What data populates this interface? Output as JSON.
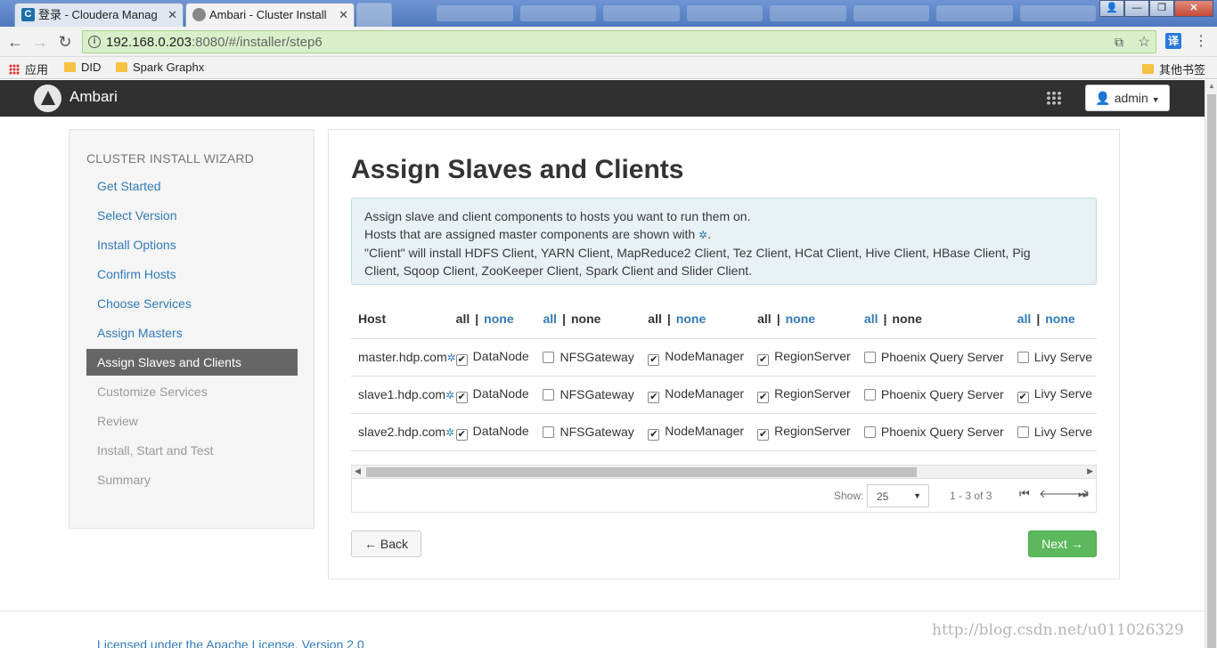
{
  "browser": {
    "tabs": [
      {
        "label": "登录 - Cloudera Manag",
        "favicon_color": "#1a6fa8",
        "favicon_letter": "C"
      },
      {
        "label": "Ambari - Cluster Install",
        "favicon_color": "#888888"
      }
    ],
    "url_host": "192.168.0.203",
    "url_rest": ":8080/#/installer/step6",
    "bookmarks": [
      {
        "label": "应用"
      },
      {
        "label": "DID"
      },
      {
        "label": "Spark Graphx"
      },
      {
        "label": "其他书签"
      }
    ],
    "translate_icon": "译"
  },
  "header": {
    "app_name": "Ambari",
    "admin_label": "admin"
  },
  "sidebar": {
    "title": "CLUSTER INSTALL WIZARD",
    "items": [
      {
        "label": "Get Started",
        "state": "link"
      },
      {
        "label": "Select Version",
        "state": "link"
      },
      {
        "label": "Install Options",
        "state": "link"
      },
      {
        "label": "Confirm Hosts",
        "state": "link"
      },
      {
        "label": "Choose Services",
        "state": "link"
      },
      {
        "label": "Assign Masters",
        "state": "link"
      },
      {
        "label": "Assign Slaves and Clients",
        "state": "active"
      },
      {
        "label": "Customize Services",
        "state": "disabled"
      },
      {
        "label": "Review",
        "state": "disabled"
      },
      {
        "label": "Install, Start and Test",
        "state": "disabled"
      },
      {
        "label": "Summary",
        "state": "disabled"
      }
    ]
  },
  "main": {
    "title": "Assign Slaves and Clients",
    "alert": {
      "line1": "Assign slave and client components to hosts you want to run them on.",
      "line2_pre": "Hosts that are assigned master components are shown with ",
      "line2_post": ".",
      "line3": "\"Client\" will install HDFS Client, YARN Client, MapReduce2 Client, Tez Client, HCat Client, Hive Client, HBase Client, Pig",
      "line4": "Client, Sqoop Client, ZooKeeper Client, Spark Client and Slider Client."
    },
    "table": {
      "host_header": "Host",
      "all_label": "all",
      "none_label": "none",
      "columns": [
        {
          "name": "DataNode",
          "active": "all"
        },
        {
          "name": "NFSGateway",
          "active": "none"
        },
        {
          "name": "NodeManager",
          "active": "all"
        },
        {
          "name": "RegionServer",
          "active": "all"
        },
        {
          "name": "Phoenix Query Server",
          "active": "none"
        },
        {
          "name": "Livy Serve",
          "active": "all"
        }
      ],
      "rows": [
        {
          "host": "master.hdp.com",
          "checks": [
            true,
            false,
            true,
            true,
            false,
            false
          ]
        },
        {
          "host": "slave1.hdp.com",
          "checks": [
            true,
            false,
            true,
            true,
            false,
            true
          ]
        },
        {
          "host": "slave2.hdp.com",
          "checks": [
            true,
            false,
            true,
            true,
            false,
            false
          ]
        }
      ]
    },
    "pager": {
      "show_label": "Show:",
      "page_size": "25",
      "range": "1 - 3 of 3"
    },
    "back_label": "← Back",
    "next_label": "Next →"
  },
  "footer": {
    "license": "Licensed under the Apache License, Version 2.0"
  },
  "watermark": "http://blog.csdn.net/u011026329"
}
